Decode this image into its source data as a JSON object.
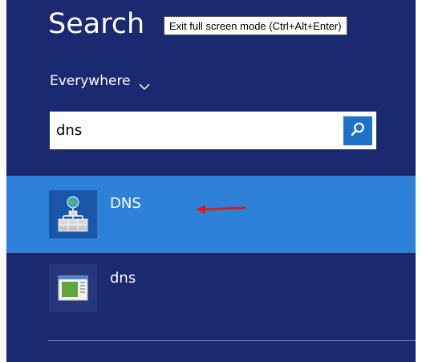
{
  "search_panel": {
    "title": "Search",
    "tooltip": "Exit full screen mode (Ctrl+Alt+Enter)",
    "scope": {
      "label": "Everywhere",
      "icon": "chevron-down-icon"
    },
    "search_box": {
      "value": "dns",
      "button_icon": "search-icon"
    },
    "results": [
      {
        "label": "DNS",
        "icon": "dns-manager-icon",
        "selected": true
      },
      {
        "label": "dns",
        "icon": "window-app-icon",
        "selected": false
      }
    ],
    "annotation": {
      "icon": "red-arrow-left-icon",
      "color": "#d32020"
    }
  },
  "colors": {
    "panel_background": "#1b2a70",
    "selected_row": "#2e81d8",
    "search_button": "#1d72c8",
    "text": "#ffffff"
  }
}
